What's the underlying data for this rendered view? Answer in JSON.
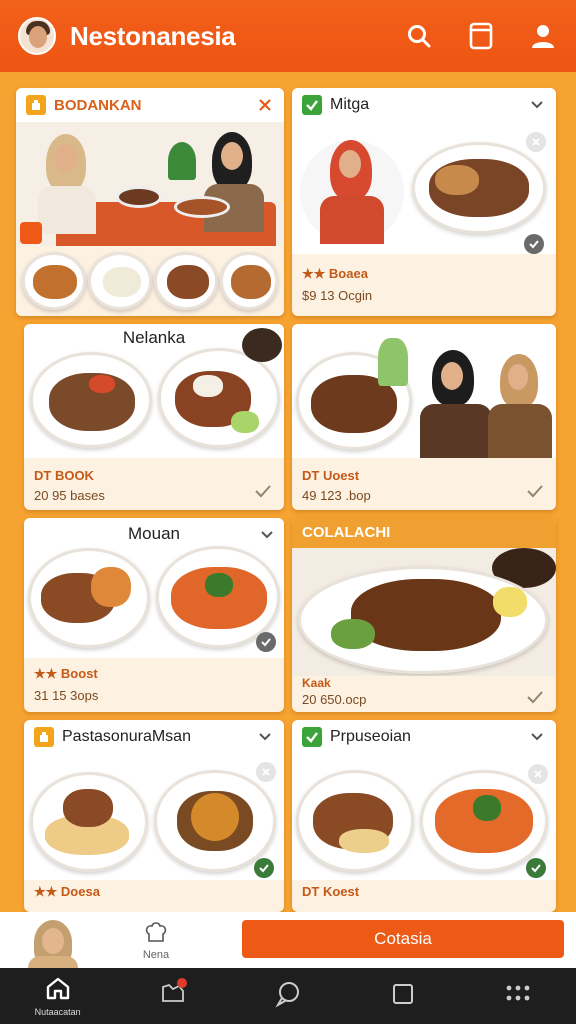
{
  "app": {
    "title": "Nestonanesia"
  },
  "header_icons": [
    "search-icon",
    "bookmark-icon",
    "profile-icon"
  ],
  "colors": {
    "accent": "#ee5412",
    "background": "#f7a331",
    "card": "#fdf1e2",
    "check": "#3aa33a"
  },
  "cards": [
    {
      "title": "BODANKAN",
      "line1": "",
      "line2": ""
    },
    {
      "title": "Mitga",
      "line1": "Boaea",
      "line2": "$9 13 Ocgin"
    },
    {
      "title": "Nelanka",
      "line1": "DT BOOK",
      "line2": "20 95 bases"
    },
    {
      "title": "",
      "line1": "DT Uoest",
      "line2": "49 123 .bop"
    },
    {
      "title": "Mouan",
      "line1": "Boost",
      "line2": "31 15 3ops"
    },
    {
      "title": "COLALACHI",
      "line1": "Kaak",
      "line2": "20 650.ocp"
    },
    {
      "title": "PastasonuraMsan",
      "line1": "Doesa",
      "line2": ""
    },
    {
      "title": "Prpuseoian",
      "line1": "DT Koest",
      "line2": ""
    }
  ],
  "bottom": {
    "nav_label": "Nena",
    "cta": "Cotasia"
  },
  "navbar": {
    "home_label": "Nutaacatan"
  }
}
